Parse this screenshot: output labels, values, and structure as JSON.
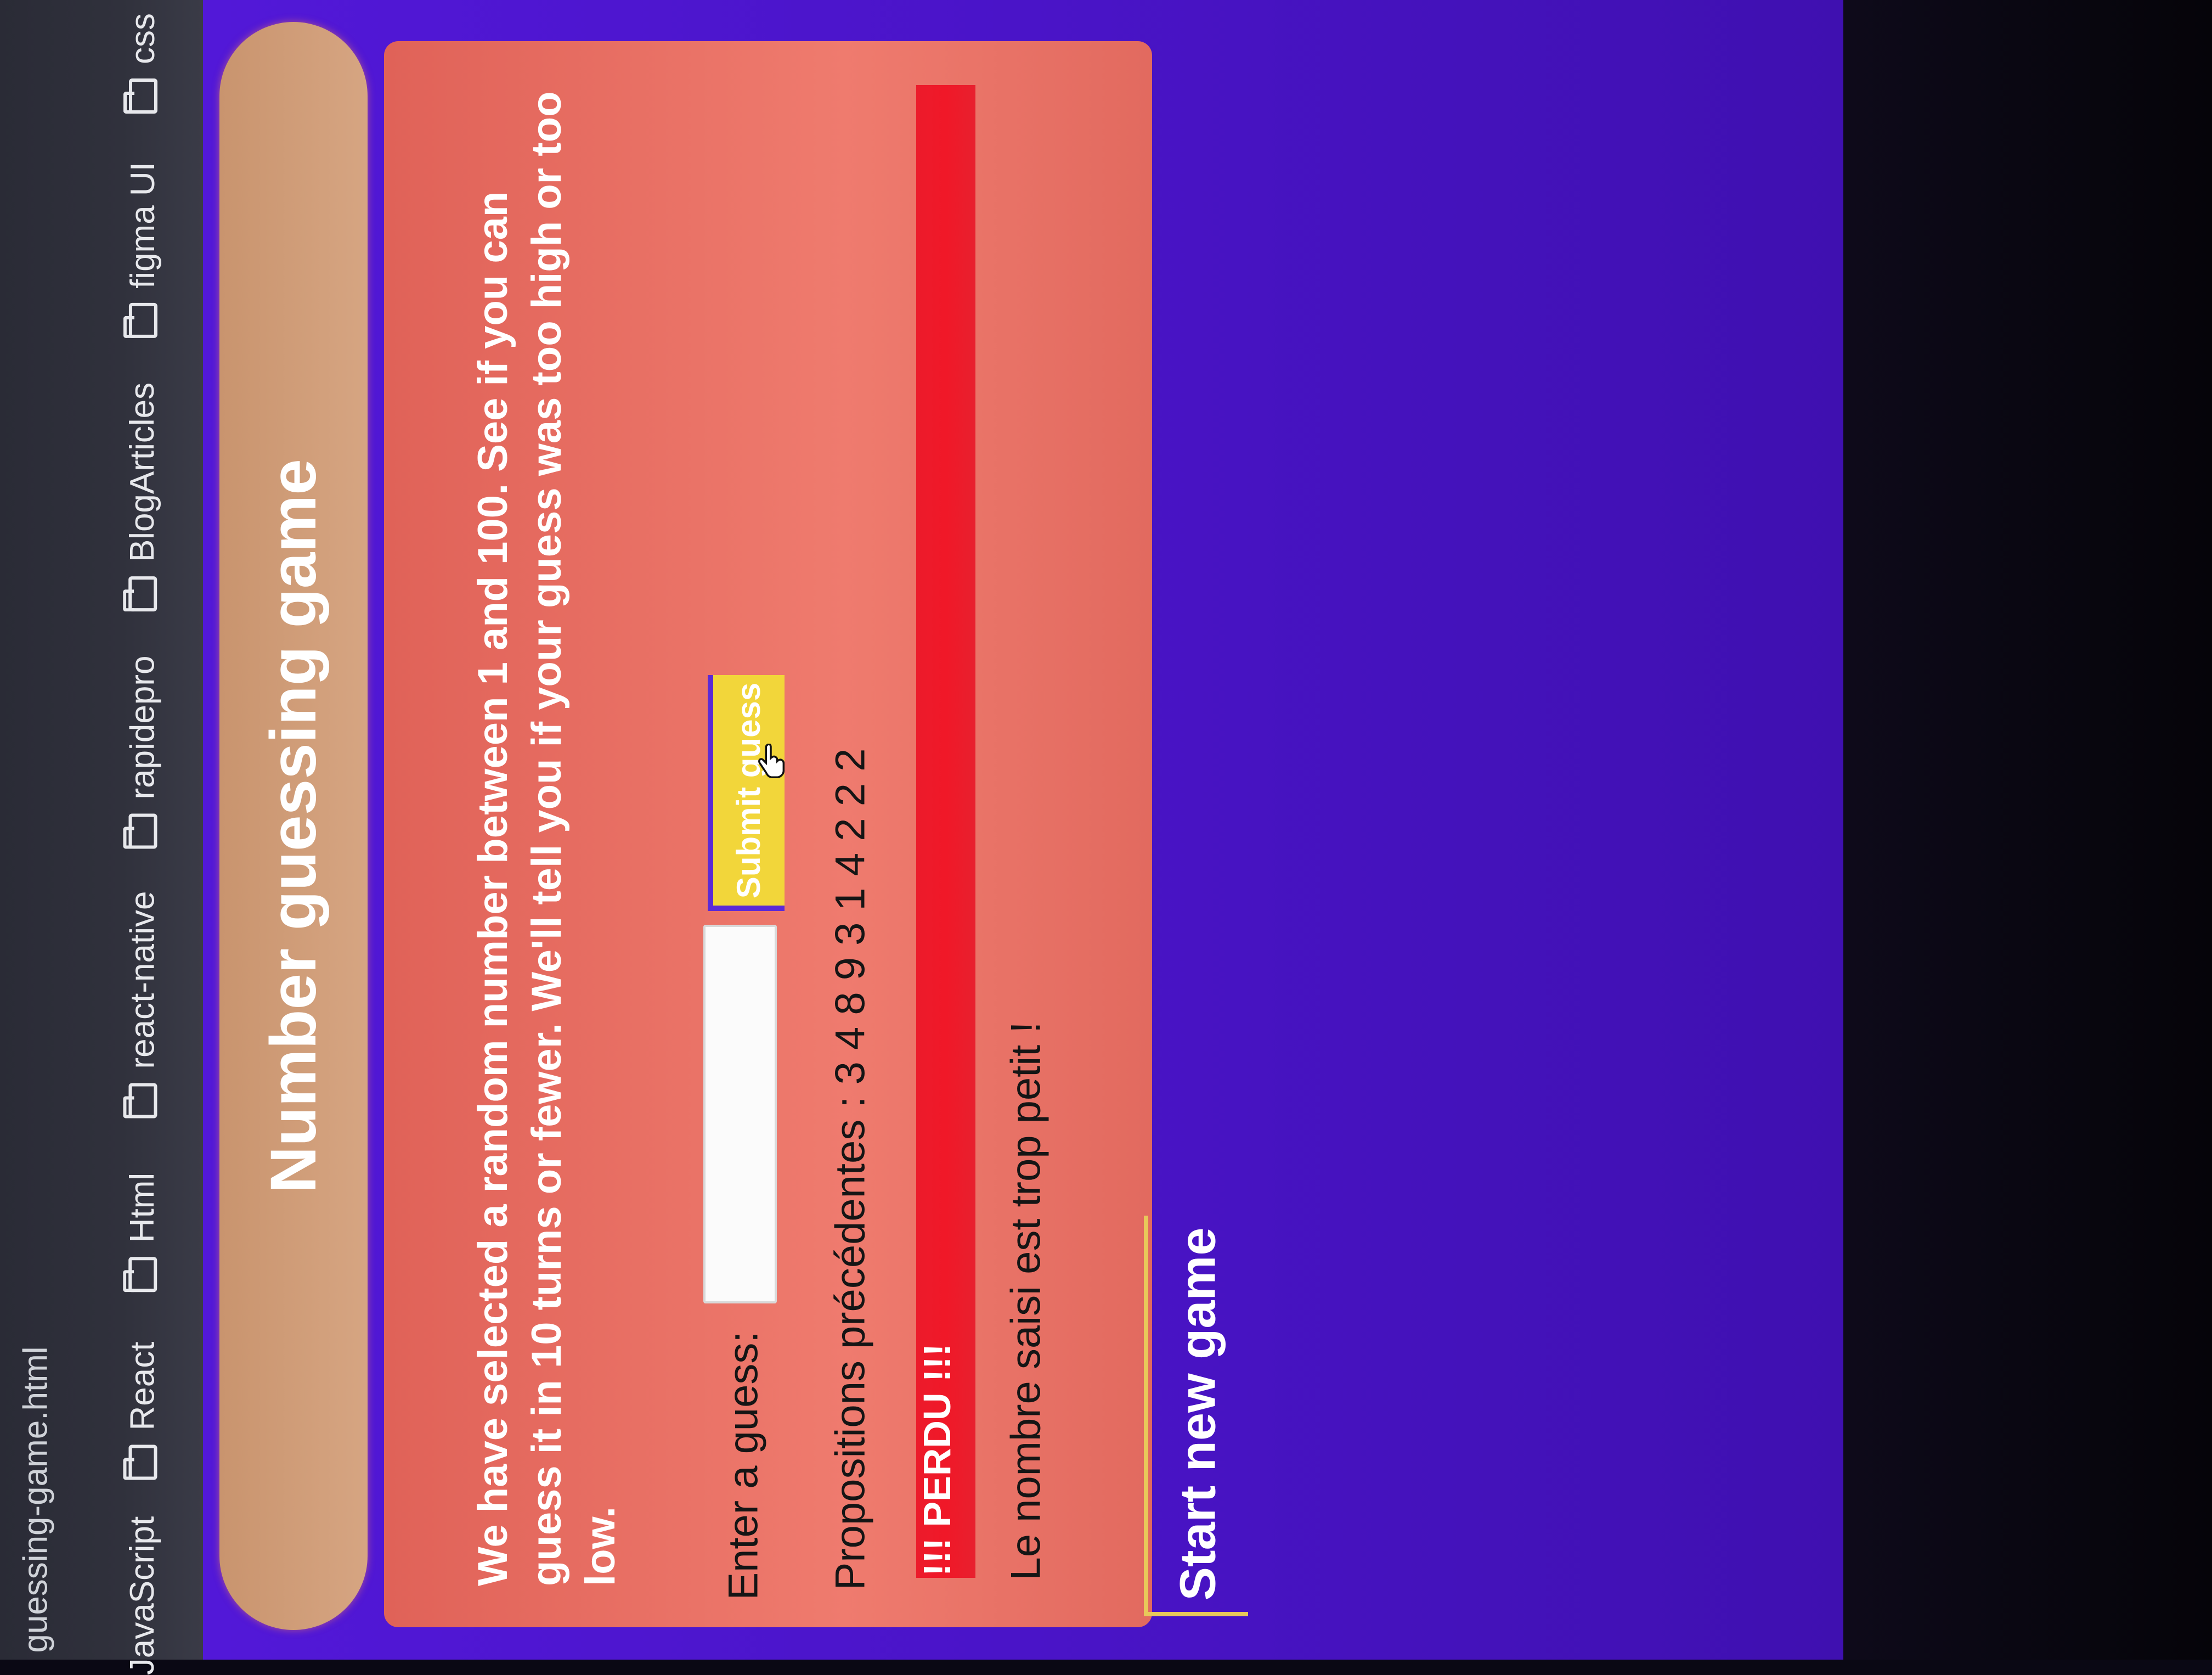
{
  "browser": {
    "tab_title": "guessing-game.html",
    "bookmarks": [
      "JavaScript",
      "React",
      "Html",
      "react-native",
      "rapidepro",
      "BlogArticles",
      "figma UI",
      "css"
    ]
  },
  "page": {
    "title": "Number guessing game",
    "intro": "We have selected a random number between 1 and 100. See if you can guess it in 10 turns or fewer. We'll tell you if your guess was too high or too low.",
    "guess_label": "Enter a guess:",
    "guess_value": "",
    "submit_label": "Submit guess",
    "previous_guesses": "Propositions précédentes : 3 4 8 9 3 1 4 2 2 2",
    "result": "!!! PERDU !!!",
    "hint": "Le nombre saisi est trop petit !",
    "new_game_label": "Start new game"
  },
  "colors": {
    "background": "#4a14c8",
    "card": "#ef7b6e",
    "header": "#d6a582",
    "result_bar": "#f01828",
    "submit": "#f2d63a",
    "new_game_border": "#e8c85a"
  }
}
